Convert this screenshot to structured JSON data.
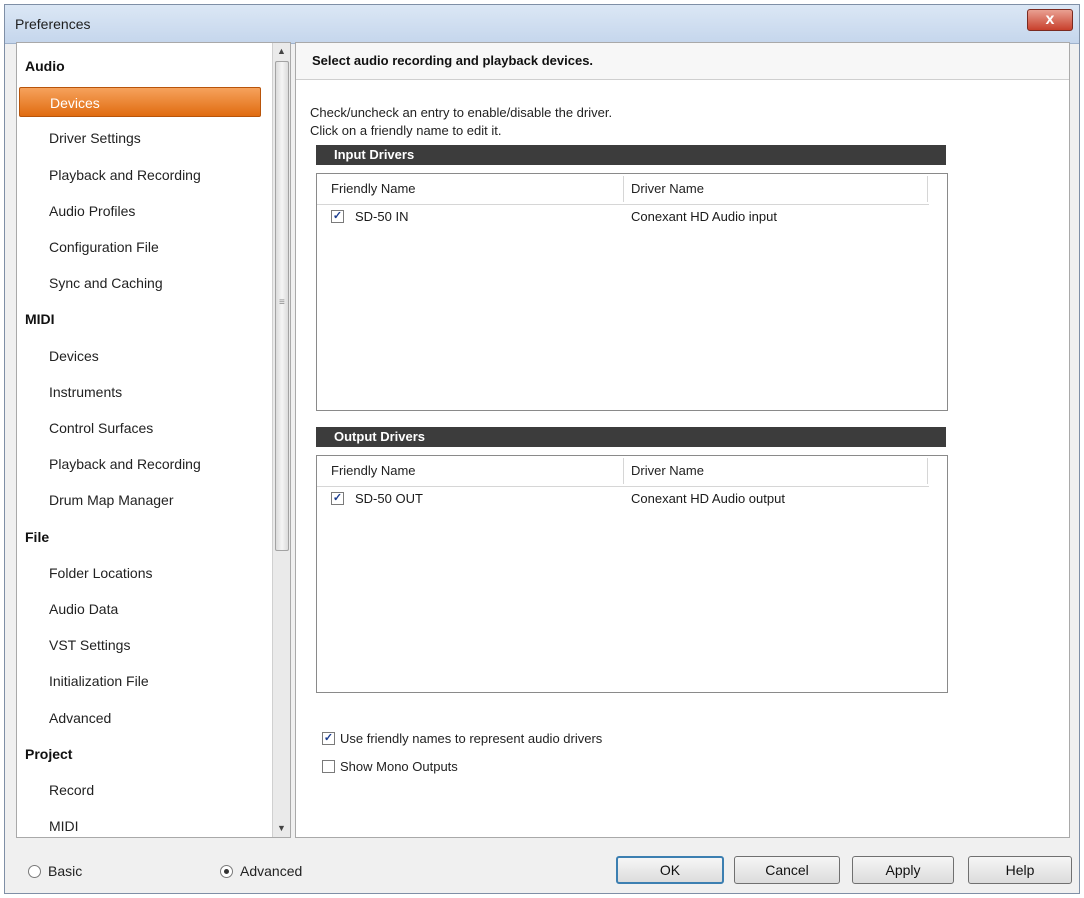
{
  "window": {
    "title": "Preferences",
    "close_glyph": "x"
  },
  "nav": {
    "items": [
      {
        "label": "Audio",
        "type": "category"
      },
      {
        "label": "Devices",
        "type": "item",
        "selected": true
      },
      {
        "label": "Driver Settings",
        "type": "item"
      },
      {
        "label": "Playback and Recording",
        "type": "item"
      },
      {
        "label": "Audio Profiles",
        "type": "item"
      },
      {
        "label": "Configuration File",
        "type": "item"
      },
      {
        "label": "Sync and Caching",
        "type": "item"
      },
      {
        "label": "MIDI",
        "type": "category"
      },
      {
        "label": "Devices",
        "type": "item"
      },
      {
        "label": "Instruments",
        "type": "item"
      },
      {
        "label": "Control Surfaces",
        "type": "item"
      },
      {
        "label": "Playback and Recording",
        "type": "item"
      },
      {
        "label": "Drum Map Manager",
        "type": "item"
      },
      {
        "label": "File",
        "type": "category"
      },
      {
        "label": "Folder Locations",
        "type": "item"
      },
      {
        "label": "Audio Data",
        "type": "item"
      },
      {
        "label": "VST Settings",
        "type": "item"
      },
      {
        "label": "Initialization File",
        "type": "item"
      },
      {
        "label": "Advanced",
        "type": "item"
      },
      {
        "label": "Project",
        "type": "category"
      },
      {
        "label": "Record",
        "type": "item"
      },
      {
        "label": "MIDI",
        "type": "item"
      }
    ]
  },
  "panel": {
    "header": "Select audio recording and playback devices.",
    "instruction_1": "Check/uncheck an entry to enable/disable the driver.",
    "instruction_2": "Click on a friendly name to edit it.",
    "input_section": "Input Drivers",
    "output_section": "Output Drivers",
    "col_friendly": "Friendly Name",
    "col_driver": "Driver Name",
    "input_rows": [
      {
        "friendly": "SD-50 IN",
        "driver": "Conexant HD Audio input",
        "checked": true
      }
    ],
    "output_rows": [
      {
        "friendly": "SD-50 OUT",
        "driver": "Conexant HD Audio output",
        "checked": true
      }
    ],
    "opt_friendly_names": {
      "label": "Use friendly names to represent audio drivers",
      "checked": true
    },
    "opt_mono_outputs": {
      "label": "Show Mono Outputs",
      "checked": false
    }
  },
  "footer": {
    "radio_basic": {
      "label": "Basic",
      "selected": false
    },
    "radio_advanced": {
      "label": "Advanced",
      "selected": true
    },
    "ok": "OK",
    "cancel": "Cancel",
    "apply": "Apply",
    "help": "Help"
  }
}
